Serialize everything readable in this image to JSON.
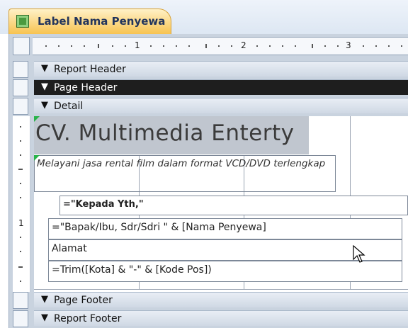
{
  "tab": {
    "label": "Label Nama Penyewa",
    "icon": "report-icon"
  },
  "ruler": {
    "marks": [
      "1",
      "2",
      "3"
    ]
  },
  "sections": {
    "report_header": "Report Header",
    "page_header": "Page Header",
    "detail": "Detail",
    "page_footer": "Page Footer",
    "report_footer": "Report Footer"
  },
  "controls": {
    "title": "CV. Multimedia Enterty",
    "subtitle": "Melayani jasa rental film dalam format VCD/DVD terlengkap",
    "kepada": "=\"Kepada Yth,\"",
    "nama": "=\"Bapak/Ibu, Sdr/Sdri \" & [Nama Penyewa]",
    "alamat": "Alamat",
    "kota": "=Trim([Kota] & \"-\" & [Kode Pos])"
  },
  "vertical_ruler": {
    "mark": "1"
  },
  "colors": {
    "tab_accent": "#f7c24d",
    "page_header_bar": "#1e1e1e"
  }
}
